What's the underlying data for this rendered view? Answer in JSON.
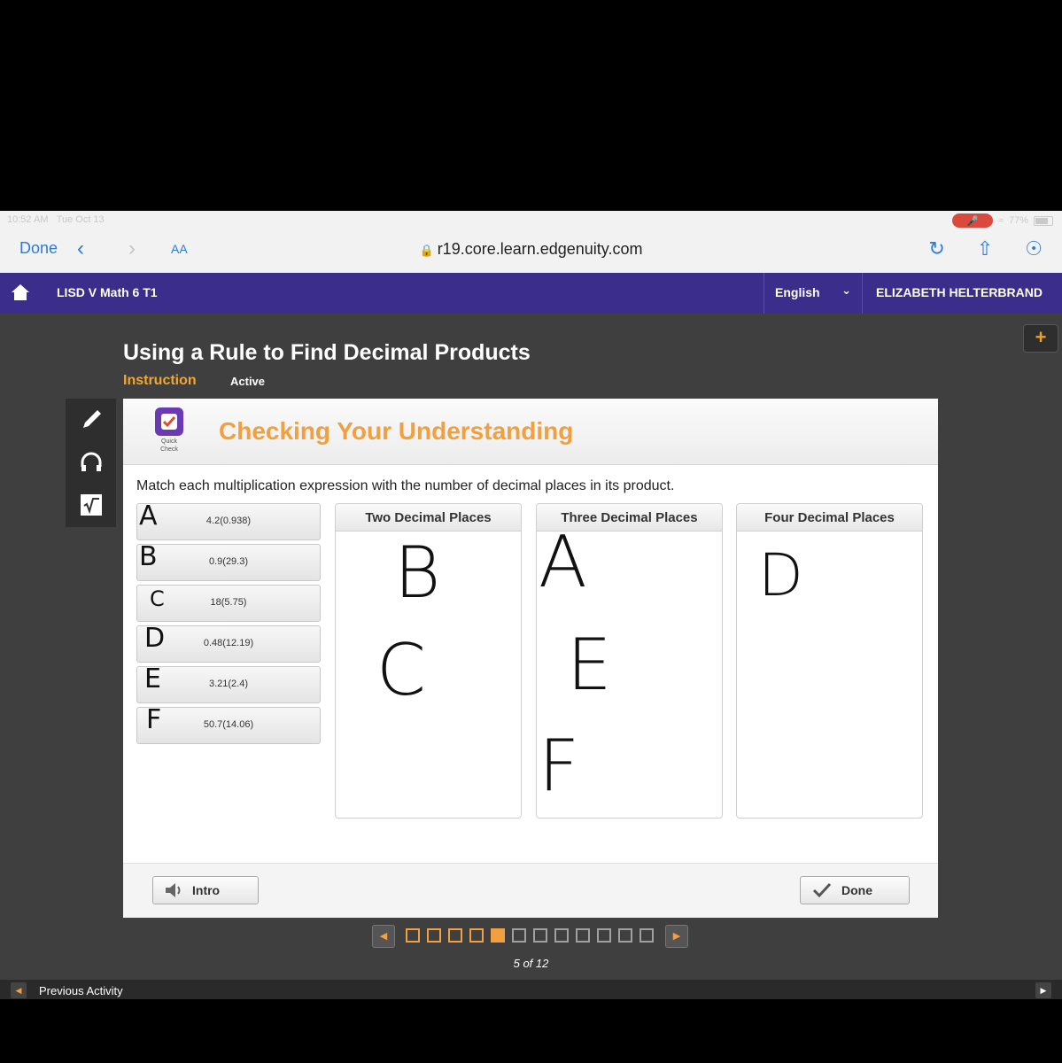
{
  "status": {
    "time": "10:52 AM",
    "date": "Tue Oct 13",
    "battery": "77%"
  },
  "safari": {
    "done": "Done",
    "aa": "AA",
    "url": "r19.core.learn.edgenuity.com"
  },
  "header": {
    "course": "LISD V Math 6 T1",
    "language": "English",
    "user": "ELIZABETH HELTERBRAND"
  },
  "lesson": {
    "title": "Using a Rule to Find Decimal Products",
    "tab_instruction": "Instruction",
    "tab_active": "Active",
    "plus": "+"
  },
  "activity": {
    "badge_label": "Quick Check",
    "title": "Checking Your Understanding",
    "prompt": "Match each multiplication expression with the number of decimal places in its product.",
    "expressions": [
      {
        "mark": "A",
        "text": "4.2(0.938)"
      },
      {
        "mark": "B",
        "text": "0.9(29.3)"
      },
      {
        "mark": "C",
        "text": "18(5.75)"
      },
      {
        "mark": "D",
        "text": "0.48(12.19)"
      },
      {
        "mark": "E",
        "text": "3.21(2.4)"
      },
      {
        "mark": "F",
        "text": "50.7(14.06)"
      }
    ],
    "columns": [
      {
        "title": "Two Decimal Places",
        "marks": [
          "B",
          "C"
        ]
      },
      {
        "title": "Three Decimal Places",
        "marks": [
          "A",
          "E",
          "F"
        ]
      },
      {
        "title": "Four Decimal Places",
        "marks": [
          "D"
        ]
      }
    ],
    "intro_button": "Intro",
    "done_button": "Done"
  },
  "pager": {
    "current": 5,
    "total": 12,
    "label": "5 of 12"
  },
  "footer": {
    "previous": "Previous Activity"
  },
  "colors": {
    "accent": "#f0a040",
    "header": "#3a2d8c",
    "link": "#2d7bd8"
  }
}
